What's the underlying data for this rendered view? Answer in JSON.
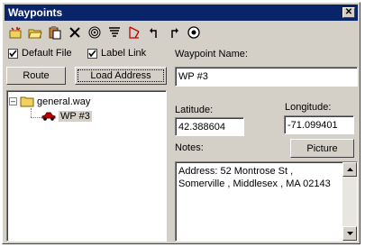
{
  "window": {
    "title": "Waypoints",
    "close_label": "x"
  },
  "toolbar": {
    "icons": [
      "new-icon",
      "open-icon",
      "paste-icon",
      "delete-icon",
      "target-icon",
      "tornado-icon",
      "route-flag-icon",
      "turn-left-icon",
      "turn-right-icon",
      "center-icon"
    ]
  },
  "options": {
    "default_file": "Default File",
    "label_link": "Label Link"
  },
  "buttons": {
    "route": "Route",
    "load_address": "Load Address",
    "picture": "Picture"
  },
  "tree": {
    "file": "general.way",
    "waypoint": "WP #3"
  },
  "form": {
    "name_label": "Waypoint Name:",
    "name_value": "WP #3",
    "lat_label": "Latitude:",
    "lat_value": "42.388604",
    "lon_label": "Longitude:",
    "lon_value": "-71.099401",
    "notes_label": "Notes:",
    "notes_value": "Address: 52 Montrose St , Somerville , Middlesex , MA 02143"
  }
}
